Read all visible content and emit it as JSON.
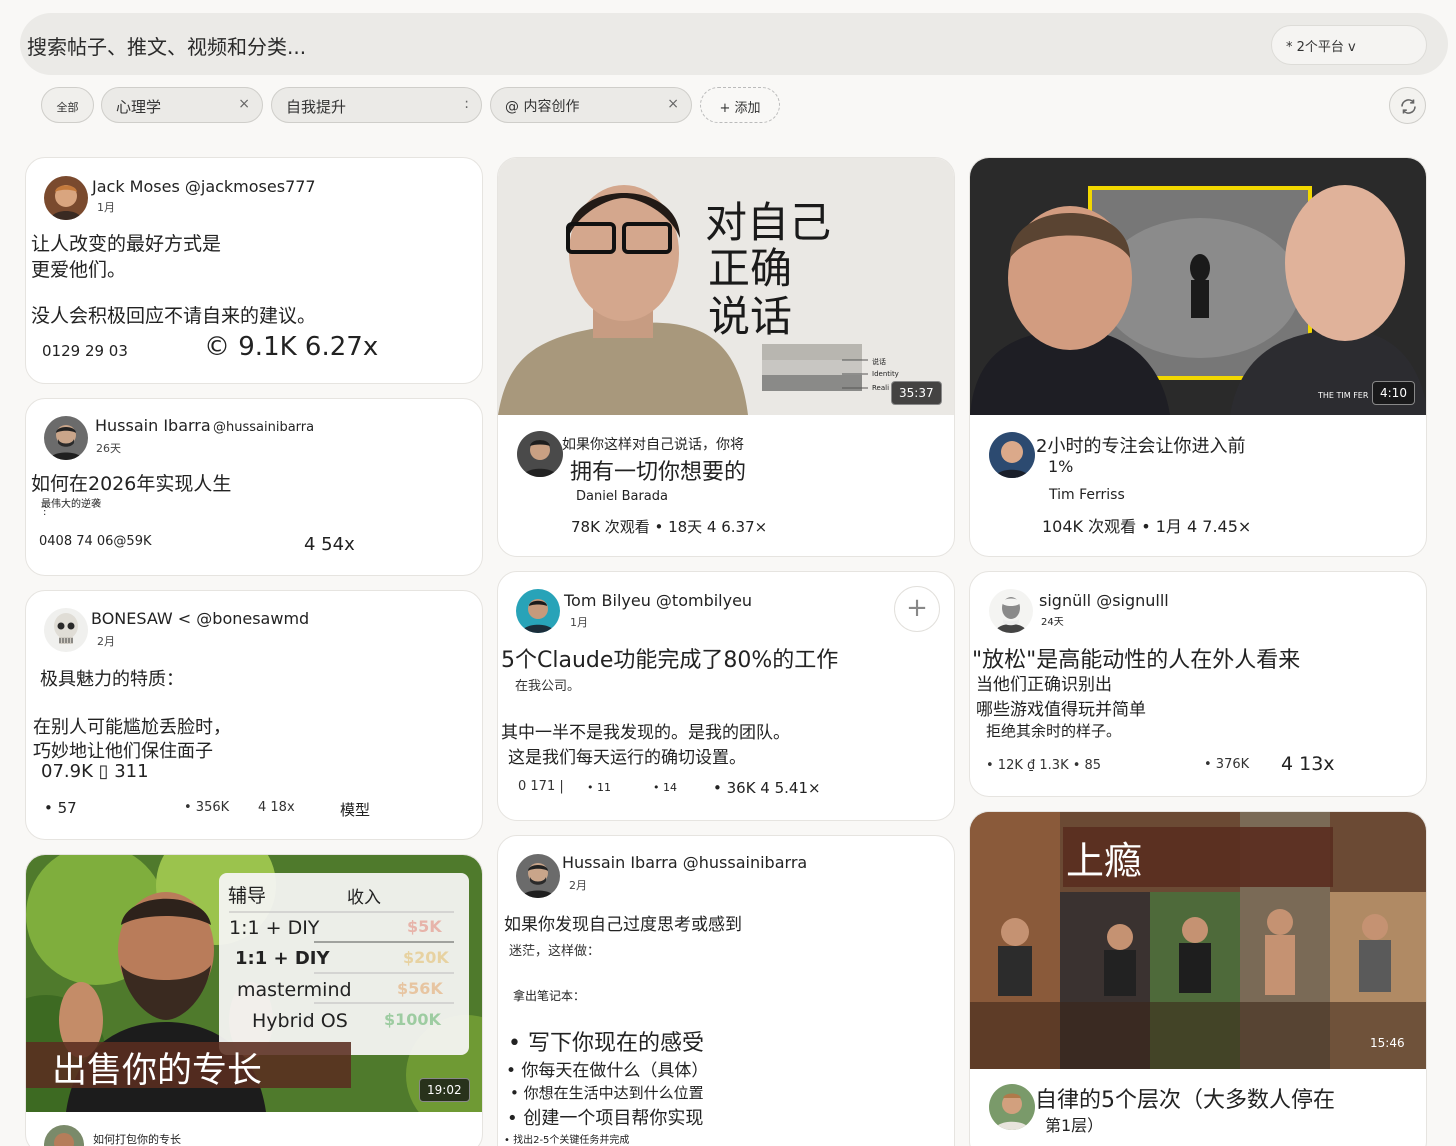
{
  "search": {
    "text": "搜索帖子、推文、视频和分类...",
    "platform_filter": "* 2个平台 v"
  },
  "filters": {
    "all": "全部",
    "chips": [
      {
        "label": "心理学",
        "close": "×"
      },
      {
        "label": "自我提升",
        "close": ":"
      },
      {
        "label": "@ 内容创作",
        "close": "×"
      }
    ],
    "add": "+ 添加"
  },
  "cards": {
    "c1": {
      "name": "Jack Moses @jackmoses777",
      "time": "1月",
      "line1": "让人改变的最好方式是",
      "line2": " 更爱他们。",
      "line3": "没人会积极回应不请自来的建议。",
      "stats": "0129 29 03",
      "score": "© 9.1K 6.27x"
    },
    "c2": {
      "name": "Hussain Ibarra",
      "handle": "@hussainibarra",
      "time": "26天",
      "title": "如何在2026年实现人生",
      "sub": "最伟大的逆袭",
      "sub2": ":",
      "stats": "0408 74 06@59K",
      "score": "4 54x"
    },
    "c3": {
      "name": "BONESAW < @bonesawmd",
      "time": "2月",
      "line1": "极具魅力的特质：",
      "line2": "在别人可能尴尬丢脸时，",
      "line3": "巧妙地让他们保住面子",
      "line4": "07.9K ▯ 311",
      "s1": "• 57",
      "s2": "• 356K",
      "s3": "4 18x",
      "s4": "模型"
    },
    "c4": {
      "table_h1": "辅导",
      "table_h2": "收入",
      "r1": "1:1 + DIY",
      "r2": "1:1 + DIY",
      "r3": "mastermind",
      "r4": "Hybrid OS",
      "v1": "$5K",
      "v2": "$20K",
      "v3": "$56K",
      "v4": "$100K",
      "banner": "出售你的专长",
      "duration": "19:02",
      "caption": "如何打包你的专长"
    },
    "c5": {
      "overlay1": "对自己",
      "overlay2": "正确",
      "overlay3": "说话",
      "label1": "说话",
      "label2": "Identity",
      "label3": "Reali",
      "duration": "35:37",
      "title1": "如果你这样对自己说话，你将",
      "title2": "拥有一切你想要的",
      "author": "Daniel Barada",
      "meta": "78K 次观看 • 18天 4 6.37×"
    },
    "c6": {
      "name": "Tom Bilyeu @tombilyeu",
      "time": "1月",
      "plus": "+",
      "title": "5个Claude功能完成了80%的工作",
      "sub": "在我公司。",
      "line1": "其中一半不是我发现的。是我的团队。",
      "line2": "这是我们每天运行的确切设置。",
      "s1": "0 171 |",
      "s2": "• 11",
      "s3": "• 14",
      "s4": "• 36K 4 5.41×"
    },
    "c7": {
      "name": "Hussain Ibarra @hussainibarra",
      "time": "2月",
      "line1": "如果你发现自己过度思考或感到",
      "line2": "迷茫，这样做：",
      "line3": "拿出笔记本：",
      "b1": "• 写下你现在的感受",
      "b2": "• 你每天在做什么（具体）",
      "b3": "• 你想在生活中达到什么位置",
      "b4": "• 创建一个项目帮你实现",
      "b5": "• 找出2-5个关键任务并完成"
    },
    "c8": {
      "watermark": "THE TIM FER",
      "duration": "4:10",
      "title1": "2小时的专注会让你进入前",
      "title2": "1%",
      "author": "Tim Ferriss",
      "meta": "104K 次观看 • 1月 4 7.45×"
    },
    "c9": {
      "name": "signüll @signulll",
      "time": "24天",
      "line1": "\"放松\"是高能动性的人在外人看来",
      "line2": "当他们正确识别出",
      "line3": "哪些游戏值得玩并简单",
      "line4": "拒绝其余时的样子。",
      "s1": "• 12K ₫ 1.3K • 85",
      "s2": "• 376K",
      "score": "4 13x"
    },
    "c10": {
      "banner": "上瘾",
      "duration": "15:46",
      "title1": "自律的5个层次（大多数人停在",
      "title2": "第1层）"
    }
  },
  "colors": {
    "page_bg": "#f9f8f6",
    "card_bg": "#ffffff",
    "search_bg": "#ebeae7",
    "banner_brown": "#5a2e20"
  },
  "icons": [
    "refresh-icon",
    "plus-icon",
    "close-icon"
  ]
}
